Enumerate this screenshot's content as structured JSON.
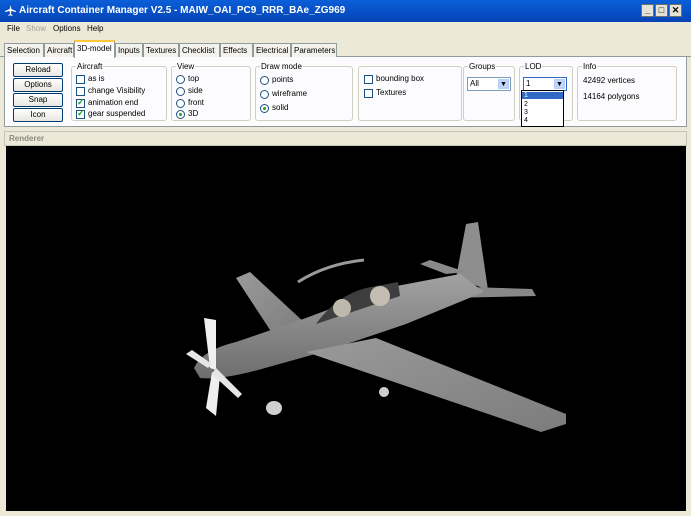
{
  "window": {
    "title": "Aircraft Container Manager V2.5   -   MAIW_OAI_PC9_RRR_BAe_ZG969",
    "min_label": "_",
    "max_label": "□",
    "close_label": "✕"
  },
  "menu": [
    "File",
    "Show",
    "Options",
    "Help"
  ],
  "tabs": [
    "Selection",
    "Aircraft",
    "3D-model",
    "Inputs",
    "Textures",
    "Checklist",
    "Effects",
    "Electrical",
    "Parameters"
  ],
  "buttons": [
    "Reload",
    "Options",
    "Snap",
    "Icon"
  ],
  "aircraft_group": {
    "label": "Aircraft",
    "options": [
      "as is",
      "change Visibility",
      "animation end",
      "gear suspended"
    ]
  },
  "view_group": {
    "label": "View",
    "options": [
      "top",
      "side",
      "front",
      "3D"
    ]
  },
  "draw_group": {
    "label": "Draw mode",
    "options": [
      "points",
      "wireframe",
      "solid"
    ]
  },
  "extras": [
    "bounding box",
    "Textures"
  ],
  "groups": {
    "label": "Groups",
    "value": "All"
  },
  "lod": {
    "label": "LOD",
    "value": "1",
    "options": [
      "1",
      "2",
      "3",
      "4"
    ]
  },
  "info": {
    "label": "Info",
    "vertices": "42492 vertices",
    "polygons": "14164 polygons"
  },
  "renderer": {
    "label": "Renderer"
  },
  "colors": {
    "title_bar": "#0543b6",
    "selection": "#316ac5",
    "viewport_bg": "#000000",
    "airframe": "#8e8e8e"
  }
}
